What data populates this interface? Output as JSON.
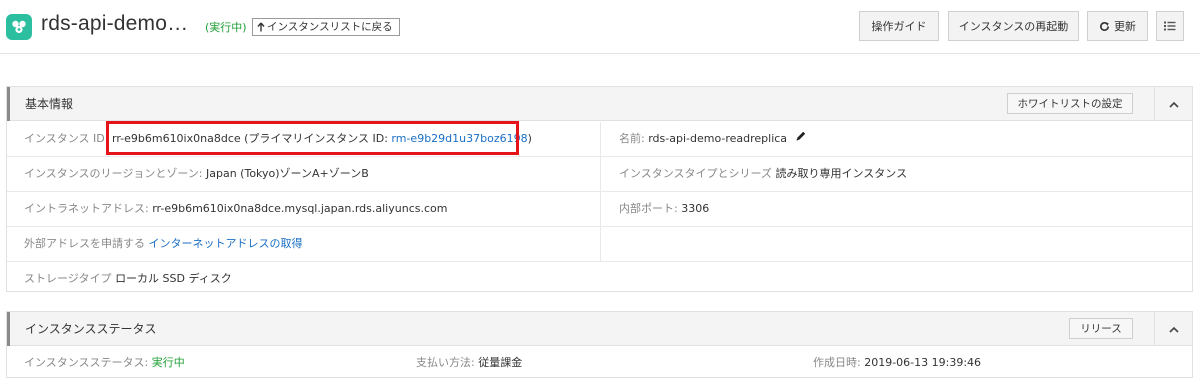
{
  "header": {
    "title": "rds-api-demo…",
    "status": "(実行中)",
    "back_label": "インスタンスリストに戻る",
    "back_icon": "up-arrow-icon",
    "guide_label": "操作ガイド",
    "restart_label": "インスタンスの再起動",
    "refresh_label": "更新",
    "refresh_icon": "refresh-icon",
    "list_icon": "list-icon",
    "app_icon": "rds-app-icon"
  },
  "basic_info": {
    "title": "基本情報",
    "whitelist_label": "ホワイトリストの設定",
    "instance_id_label": "インスタンス ID:",
    "instance_id_value": "rr-e9b6m610ix0na8dce",
    "primary_prefix": "(プライマリインスタンス ID:",
    "primary_id": "rm-e9b29d1u37boz6198",
    "primary_suffix": ")",
    "name_label": "名前:",
    "name_value": "rds-api-demo-readreplica",
    "region_label": "インスタンスのリージョンとゾーン:",
    "region_value": "Japan (Tokyo)ゾーンA+ゾーンB",
    "type_label": "インスタンスタイプとシリーズ",
    "type_value": "読み取り専用インスタンス",
    "intranet_label": "イントラネットアドレス:",
    "intranet_value": "rr-e9b6m610ix0na8dce.mysql.japan.rds.aliyuncs.com",
    "port_label": "内部ポート:",
    "port_value": "3306",
    "public_label": "外部アドレスを申請する",
    "public_link": "インターネットアドレスの取得",
    "storage_label": "ストレージタイプ",
    "storage_value": "ローカル SSD ディスク"
  },
  "instance_status": {
    "title": "インスタンスステータス",
    "release_label": "リリース",
    "status_label": "インスタンスステータス:",
    "status_value": "実行中",
    "billing_label": "支払い方法:",
    "billing_value": "従量課金",
    "created_label": "作成日時:",
    "created_value": "2019-06-13 19:39:46"
  },
  "colors": {
    "accent_green": "#1e9e33",
    "link_blue": "#1a6fc5",
    "highlight_red": "#e5141b",
    "app_icon": "#2bbfa0"
  }
}
